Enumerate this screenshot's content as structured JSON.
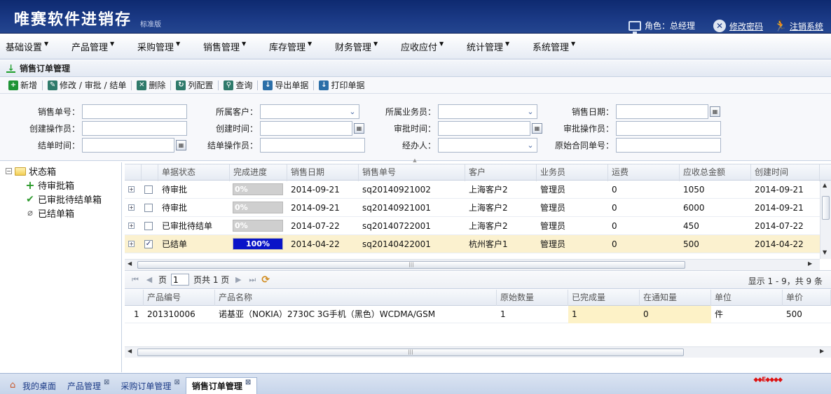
{
  "header": {
    "app_title": "唯赛软件进销存",
    "edition": "标准版",
    "role_label": "角色：总经理",
    "change_password": "修改密码",
    "logout": "注销系统"
  },
  "menu": {
    "items": [
      "基础设置",
      "产品管理",
      "采购管理",
      "销售管理",
      "库存管理",
      "财务管理",
      "应收应付",
      "统计管理",
      "系统管理"
    ]
  },
  "panel": {
    "title": "销售订单管理"
  },
  "toolbar": {
    "add": "新增",
    "modify": "修改 / 审批 / 结单",
    "delete": "删除",
    "columns": "列配置",
    "query": "查询",
    "export": "导出单据",
    "print": "打印单据"
  },
  "search": {
    "labels": {
      "order_no": "销售单号：",
      "customer": "所属客户：",
      "salesman": "所属业务员：",
      "sale_date": "销售日期：",
      "creator": "创建操作员：",
      "create_time": "创建时间：",
      "approve_time": "审批时间：",
      "approver": "审批操作员：",
      "close_time": "结单时间：",
      "closer": "结单操作员：",
      "handler": "经办人：",
      "contract_no": "原始合同单号："
    }
  },
  "tree": {
    "root": "状态箱",
    "children": [
      "待审批箱",
      "已审批待结单箱",
      "已结单箱"
    ]
  },
  "grid": {
    "columns": [
      "单据状态",
      "完成进度",
      "销售日期",
      "销售单号",
      "客户",
      "业务员",
      "运费",
      "应收总金额",
      "创建时间"
    ],
    "rows": [
      {
        "status": "待审批",
        "progress_text": "0%",
        "progress": 0,
        "date": "2014-09-21",
        "order_no": "sq20140921002",
        "customer": "上海客户2",
        "salesman": "管理员",
        "freight": "0",
        "amount": "1050",
        "created": "2014-09-21",
        "checked": false
      },
      {
        "status": "待审批",
        "progress_text": "0%",
        "progress": 0,
        "date": "2014-09-21",
        "order_no": "sq20140921001",
        "customer": "上海客户2",
        "salesman": "管理员",
        "freight": "0",
        "amount": "6000",
        "created": "2014-09-21",
        "checked": false
      },
      {
        "status": "已审批待结单",
        "progress_text": "0%",
        "progress": 0,
        "date": "2014-07-22",
        "order_no": "sq20140722001",
        "customer": "上海客户2",
        "salesman": "管理员",
        "freight": "0",
        "amount": "450",
        "created": "2014-07-22",
        "checked": false
      },
      {
        "status": "已结单",
        "progress_text": "100%",
        "progress": 100,
        "date": "2014-04-22",
        "order_no": "sq20140422001",
        "customer": "杭州客户1",
        "salesman": "管理员",
        "freight": "0",
        "amount": "500",
        "created": "2014-04-22",
        "checked": true
      }
    ]
  },
  "pager": {
    "page_label": "页",
    "page_value": "1",
    "total_label": "页共 1 页",
    "info": "显示 1 - 9，共 9 条"
  },
  "detail": {
    "columns": [
      "产品编号",
      "产品名称",
      "原始数量",
      "已完成量",
      "在通知量",
      "单位",
      "单价"
    ],
    "rows": [
      {
        "index": "1",
        "code": "201310006",
        "name": "诺基亚（NOKIA）2730C 3G手机（黑色）WCDMA/GSM",
        "qty": "1",
        "done": "1",
        "notice": "0",
        "unit": "件",
        "price": "500"
      }
    ]
  },
  "tabs": {
    "items": [
      "我的桌面",
      "产品管理",
      "采购订单管理",
      "销售订单管理"
    ],
    "active": 3
  },
  "colors": {
    "header_bg": "#1b3a86",
    "progress_fill": "#0a14c8",
    "selected_row": "#fbf1cf"
  }
}
